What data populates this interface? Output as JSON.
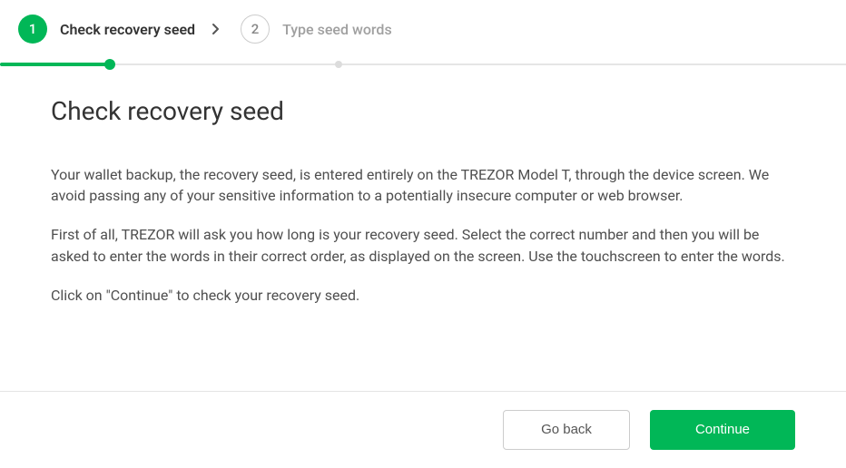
{
  "stepper": {
    "step1": {
      "number": "1",
      "label": "Check recovery seed"
    },
    "step2": {
      "number": "2",
      "label": "Type seed words"
    }
  },
  "content": {
    "title": "Check recovery seed",
    "p1": "Your wallet backup, the recovery seed, is entered entirely on the TREZOR Model T, through the device screen. We avoid passing any of your sensitive information to a potentially insecure computer or web browser.",
    "p2": "First of all, TREZOR will ask you how long is your recovery seed. Select the correct number and then you will be asked to enter the words in their correct order, as displayed on the screen. Use the touchscreen to enter the words.",
    "p3": "Click on \"Continue\" to check your recovery seed."
  },
  "footer": {
    "back": "Go back",
    "continue": "Continue"
  },
  "colors": {
    "accent": "#01B757"
  }
}
